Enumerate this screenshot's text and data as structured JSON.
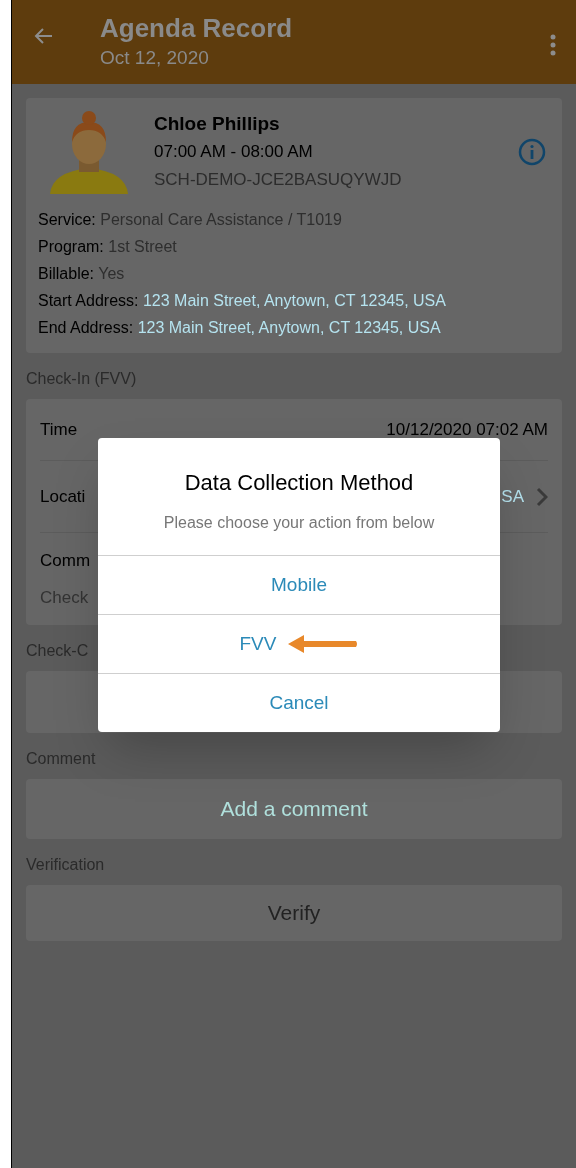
{
  "app_bar": {
    "title": "Agenda Record",
    "subtitle": "Oct 12, 2020"
  },
  "client": {
    "name": "Chloe Phillips",
    "time": "07:00 AM - 08:00 AM",
    "code": "SCH-DEMO-JCE2BASUQYWJD",
    "details": [
      {
        "label": "Service:",
        "value": "Personal Care Assistance / T1019",
        "kind": "text"
      },
      {
        "label": "Program:",
        "value": "1st Street",
        "kind": "text"
      },
      {
        "label": "Billable:",
        "value": "Yes",
        "kind": "text"
      },
      {
        "label": "Start Address:",
        "value": "123 Main Street, Anytown, CT 12345, USA",
        "kind": "link"
      },
      {
        "label": "End Address:",
        "value": "123 Main Street, Anytown, CT 12345, USA",
        "kind": "link"
      }
    ]
  },
  "check_in": {
    "heading": "Check-In (FVV)",
    "time_label": "Time",
    "time_value": "10/12/2020 07:02 AM",
    "location_label": "Locati",
    "location_value": "SA",
    "comment_label": "Comm",
    "comment_value": "Check"
  },
  "check_out": {
    "heading": "Check-C"
  },
  "comment": {
    "heading": "Comment",
    "button": "Add a comment"
  },
  "verification": {
    "heading": "Verification",
    "button": "Verify"
  },
  "dialog": {
    "title": "Data Collection Method",
    "message": "Please choose your action from below",
    "options": [
      {
        "label": "Mobile",
        "pointed": false
      },
      {
        "label": "FVV",
        "pointed": true
      },
      {
        "label": "Cancel",
        "pointed": false
      }
    ]
  }
}
